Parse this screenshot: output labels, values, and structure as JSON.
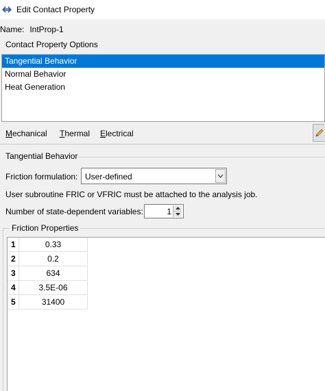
{
  "window": {
    "title": "Edit Contact Property",
    "app_icon": "abaqus-app-icon"
  },
  "name_row": {
    "label": "Name:",
    "value": "IntProp-1"
  },
  "options": {
    "label": "Contact Property Options",
    "items": [
      {
        "label": "Tangential Behavior",
        "selected": true
      },
      {
        "label": "Normal Behavior",
        "selected": false
      },
      {
        "label": "Heat Generation",
        "selected": false
      }
    ]
  },
  "menu_tabs": [
    {
      "mnemonic": "M",
      "rest": "echanical"
    },
    {
      "mnemonic": "T",
      "rest": "hermal"
    },
    {
      "mnemonic": "E",
      "rest": "lectrical"
    }
  ],
  "toolbar": {
    "edit_icon": "pencil-icon"
  },
  "section": {
    "title": "Tangential Behavior",
    "friction_formulation_label": "Friction formulation:",
    "friction_formulation_value": "User-defined",
    "note": "User subroutine FRIC or VFRIC must be attached to the analysis job.",
    "state_vars_label": "Number of state-dependent variables:",
    "state_vars_value": "1"
  },
  "friction_properties": {
    "label": "Friction Properties",
    "rows": [
      {
        "n": "1",
        "value": "0.33"
      },
      {
        "n": "2",
        "value": "0.2"
      },
      {
        "n": "3",
        "value": "634"
      },
      {
        "n": "4",
        "value": "3.5E-06"
      },
      {
        "n": "5",
        "value": "31400"
      }
    ]
  },
  "colors": {
    "selection": "#0078d7",
    "background": "#f0f0f0"
  }
}
